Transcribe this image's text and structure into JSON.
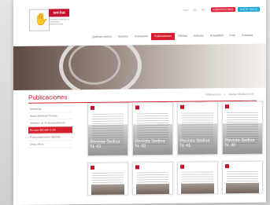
{
  "logo": {
    "brand": "seclsa",
    "subtitle": "Sociedad Española de Cardiología Intervencionista"
  },
  "top_links": [
    "Login",
    "ES",
    "EN"
  ],
  "buttons": {
    "primary": "INSCRIPCIONES",
    "secondary": "HAZTE SOCIO"
  },
  "nav": [
    "Quiénes somos",
    "Eventos",
    "Formación",
    "Publicaciones",
    "Ofertas",
    "Enlaces",
    "Actualidad",
    "Foro",
    "Contacto"
  ],
  "nav_active": "Publicaciones",
  "page_title": "Publicaciones",
  "breadcrumb": [
    "Publicaciones",
    ">",
    "Revista SEDISA S.XXI"
  ],
  "sidebar": [
    "Memorias",
    "Salud Sanitaria Privada",
    "Informes de Profesionalización",
    "Revista SEDISA S.XXI",
    "Posicionamientos SEDISA",
    "Otras obras"
  ],
  "sidebar_active": "Revista SEDISA S.XXI",
  "magazines": [
    {
      "title": "Revista Sedisa",
      "number": "N. 43"
    },
    {
      "title": "Revista Sedisa",
      "number": "N. 42"
    },
    {
      "title": "Revista Sedisa",
      "number": "N. 41"
    },
    {
      "title": "Revista Sedisa",
      "number": "N. 40"
    }
  ],
  "colors": {
    "accent": "#d61d2b",
    "blue": "#1ea7d9"
  }
}
